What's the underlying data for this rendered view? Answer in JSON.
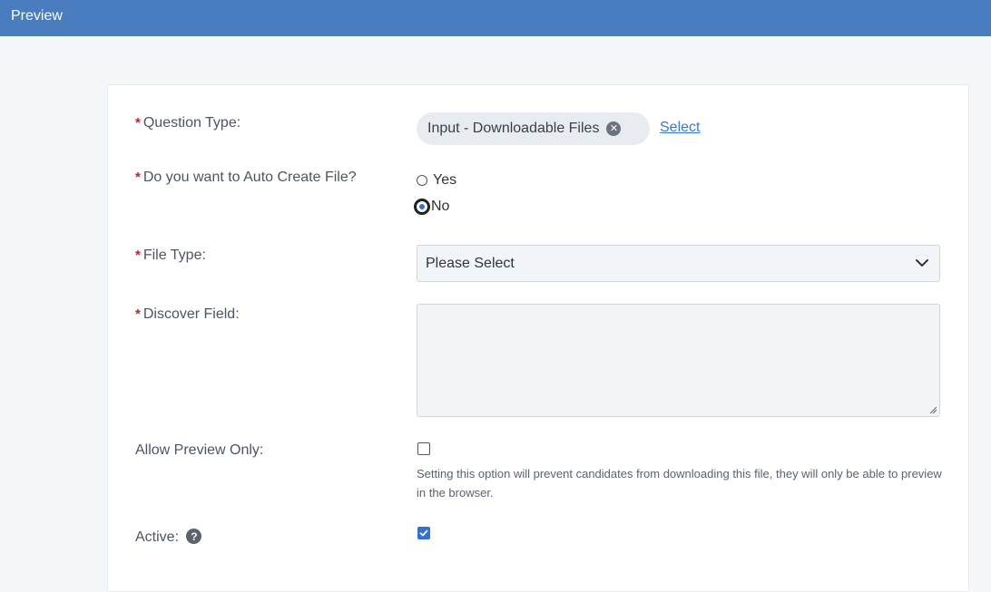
{
  "header": {
    "title": "Preview"
  },
  "form": {
    "question_type": {
      "label": "Question Type:",
      "chip_value": "Input - Downloadable Files",
      "select_link": "Select"
    },
    "auto_create": {
      "label": "Do you want to Auto Create File?",
      "options": [
        {
          "label": "Yes",
          "checked": false
        },
        {
          "label": "No",
          "checked": true
        }
      ]
    },
    "file_type": {
      "label": "File Type:",
      "selected": "Please Select"
    },
    "discover_field": {
      "label": "Discover Field:",
      "value": ""
    },
    "allow_preview": {
      "label": "Allow Preview Only:",
      "checked": false,
      "help_text": "Setting this option will prevent candidates from downloading this file, they will only be able to preview in the browser."
    },
    "active": {
      "label": "Active:",
      "checked": true,
      "help_icon": "?"
    },
    "required_marker": "*"
  },
  "colors": {
    "header_bg": "#4a7dbf",
    "required": "#c0222c",
    "link": "#3a78d8",
    "accent": "#2f6fe0"
  }
}
